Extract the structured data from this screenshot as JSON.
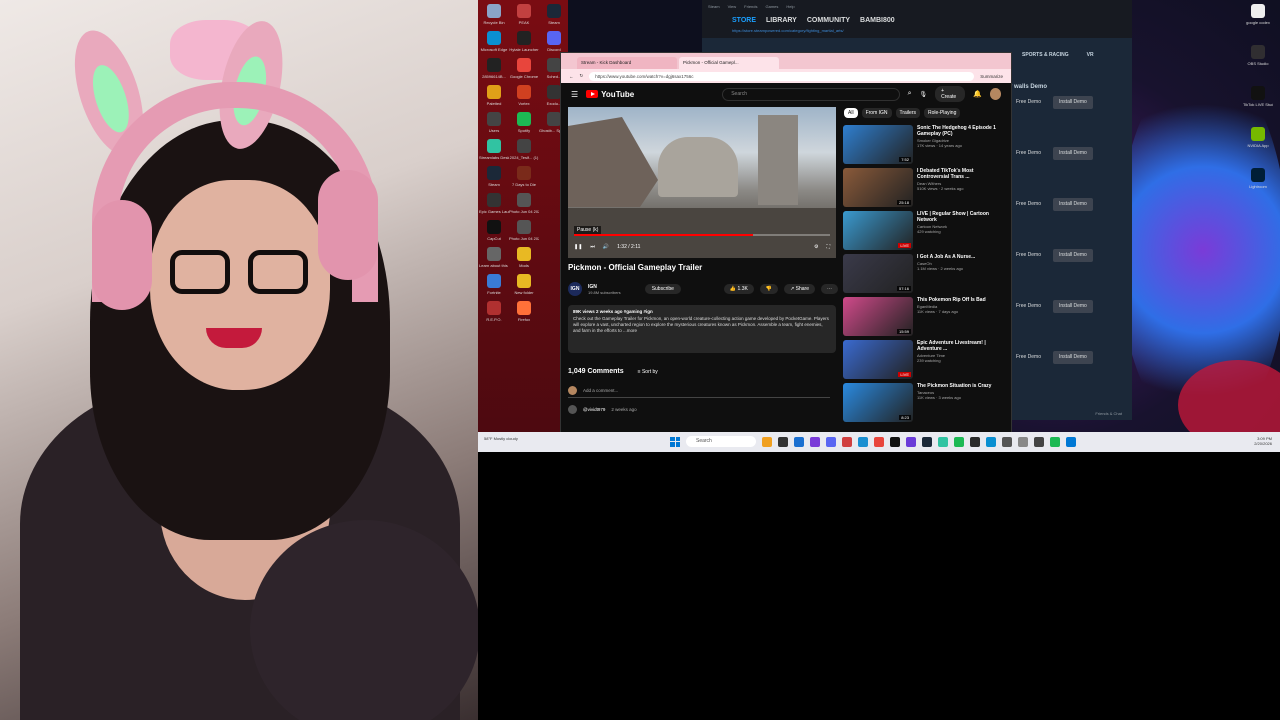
{
  "desktop": {
    "icons_col1": [
      {
        "label": "Recycle Bin",
        "color": "#8aa4c8"
      },
      {
        "label": "Microsoft Edge",
        "color": "#0a8fd1"
      },
      {
        "label": "28596614B...",
        "color": "#222222"
      },
      {
        "label": "Paletted",
        "color": "#e0a018"
      },
      {
        "label": "Users",
        "color": "#444444"
      },
      {
        "label": "Streamlabs Desktop",
        "color": "#31c3a2"
      },
      {
        "label": "Steam",
        "color": "#1b2838"
      },
      {
        "label": "Epic Games Launcher",
        "color": "#333333"
      },
      {
        "label": "CapCut",
        "color": "#111111"
      },
      {
        "label": "Learn about this picture",
        "color": "#666666"
      },
      {
        "label": "Fortnite",
        "color": "#3a7bd5"
      },
      {
        "label": "R.E.P.O.",
        "color": "#b03030"
      }
    ],
    "icons_col2": [
      {
        "label": "PEAK",
        "color": "#c24040"
      },
      {
        "label": "Hytale Launcher",
        "color": "#222222"
      },
      {
        "label": "Google Chrome",
        "color": "#e8453c"
      },
      {
        "label": "Vortex",
        "color": "#d04020"
      },
      {
        "label": "Spotify",
        "color": "#1db954"
      },
      {
        "label": "2024_Teslf... (1)",
        "color": "#444444"
      },
      {
        "label": "7 Days to Die",
        "color": "#7a2a1a"
      },
      {
        "label": "Photo Jun 04 2022, 3 45 ...",
        "color": "#555555"
      },
      {
        "label": "Photo Jun 04 2022, 3 45 ...",
        "color": "#555555"
      },
      {
        "label": "Mods",
        "color": "#e8b923"
      },
      {
        "label": "New folder",
        "color": "#e8b923"
      },
      {
        "label": "Firefox",
        "color": "#ff7139"
      }
    ],
    "icons_col3": [
      {
        "label": "Steam",
        "color": "#1b2838"
      },
      {
        "label": "Discord",
        "color": "#5865f2"
      },
      {
        "label": "Sched...",
        "color": "#444444"
      },
      {
        "label": "Exodu...",
        "color": "#333333"
      },
      {
        "label": "Ghostb... Spirits U...",
        "color": "#444444"
      }
    ],
    "icons_right": [
      {
        "label": "google codex",
        "color": "#eeeeee"
      },
      {
        "label": "OBS Studio",
        "color": "#302e31"
      },
      {
        "label": "TikTok LIVE Studio",
        "color": "#111111"
      },
      {
        "label": "NVIDIA App",
        "color": "#76b900"
      },
      {
        "label": "Lightroom",
        "color": "#001e36"
      }
    ]
  },
  "steam": {
    "menu": [
      "Steam",
      "View",
      "Friends",
      "Games",
      "Help"
    ],
    "nav": [
      "STORE",
      "LIBRARY",
      "COMMUNITY",
      "BAMBI800"
    ],
    "url": "https://store.steampowered.com/category/fighting_martial_arts/",
    "categories": [
      "SPORTS & RACING",
      "VR"
    ],
    "list_title": "r walls Demo",
    "rows": [
      {
        "free": "Free Demo",
        "install": "Install Demo"
      },
      {
        "free": "Free Demo",
        "install": "Install Demo"
      },
      {
        "free": "Free Demo",
        "install": "Install Demo"
      },
      {
        "free": "Free Demo",
        "install": "Install Demo"
      },
      {
        "free": "Free Demo",
        "install": "Install Demo"
      },
      {
        "free": "Free Demo",
        "install": "Install Demo"
      }
    ],
    "footer": "Friends & Chat"
  },
  "browser": {
    "tabs": [
      "Stream - Kick Dashboard",
      "Pickmon - Official Gamepl..."
    ],
    "url": "https://www.youtube.com/watch?v=dgj6sax1756c",
    "tools": "Summarize"
  },
  "youtube": {
    "logo": "YouTube",
    "search_placeholder": "Search",
    "create_label": "+ Create",
    "player": {
      "tooltip": "Pause (k)",
      "time": "1:32 / 2:11",
      "progress": 0.7
    },
    "video_title": "Pickmon - Official Gameplay Trailer",
    "channel": {
      "avatar": "IGN",
      "name": "IGN",
      "subs": "19.8M subscribers",
      "subscribe": "Subscribe"
    },
    "likes": "1.3K",
    "share": "Share",
    "description": {
      "meta": "89K views  2 weeks ago  #gaming #ign",
      "text": "Check out the Gameplay Trailer for Pickmon, an open-world creature-collecting action game developed by PocketGame. Players will explore a vast, uncharted region to explore the mysterious creatures known as Pickmon. Assemble a team, fight enemies, and farm in the efforts to ...more"
    },
    "comments_count": "1,049 Comments",
    "sort_label": "Sort by",
    "add_comment": "Add a comment...",
    "first_comment": {
      "user": "@vividt979",
      "ago": "2 weeks ago"
    },
    "chips": [
      "All",
      "From IGN",
      "Trailers",
      "Role-Playing"
    ],
    "recommendations": [
      {
        "title": "Sonic The Hedgehog 4 Episode 1 Gameplay (PC)",
        "channel": "Smoker Gigadrive",
        "views": "17K views · 14 years ago",
        "duration": "7:52",
        "color": "#2f7fd0"
      },
      {
        "title": "I Debated TikTok's Most Controversial Trans ...",
        "channel": "Dean Withers",
        "views": "510K views · 2 weeks ago",
        "duration": "25:18",
        "color": "#8a5a3a"
      },
      {
        "title": "LIVE | Regular Show | Cartoon Network",
        "channel": "Cartoon Network",
        "views": "429 watching",
        "duration": "LIVE",
        "color": "#3a9ad0"
      },
      {
        "title": "I Got A Job As A Nurse...",
        "channel": "CaseOh",
        "views": "1.1M views · 2 weeks ago",
        "duration": "57:16",
        "color": "#3a3a4a"
      },
      {
        "title": "This Pokemon Rip Off Is Bad",
        "channel": "EganMedia",
        "views": "11K views · 7 days ago",
        "duration": "15:59",
        "color": "#d04a8a"
      },
      {
        "title": "Epic Adventure Livestream! | Adventure ...",
        "channel": "Adventure Time",
        "views": "239 watching",
        "duration": "LIVE",
        "color": "#3a6ad0"
      },
      {
        "title": "The Pickmon Situation is Crazy",
        "channel": "Tanaceos",
        "views": "11K views · 3 weeks ago",
        "duration": "8:23",
        "color": "#2a8ae0"
      }
    ]
  },
  "taskbar": {
    "weather": "58°F Mostly cloudy",
    "search": "Search",
    "apps": [
      "#f0a020",
      "#333333",
      "#1a6fd0",
      "#7a3bd8",
      "#5865f2",
      "#d04040",
      "#1a8fd1",
      "#e8453c",
      "#111111",
      "#6a3bd8",
      "#1b2838",
      "#31c3a2",
      "#1db954",
      "#2a2a2a",
      "#0a8fd1",
      "#555555",
      "#888888",
      "#444444",
      "#1db954",
      "#0078d4"
    ],
    "time": "3:09 PM",
    "date": "2/20/2026"
  }
}
